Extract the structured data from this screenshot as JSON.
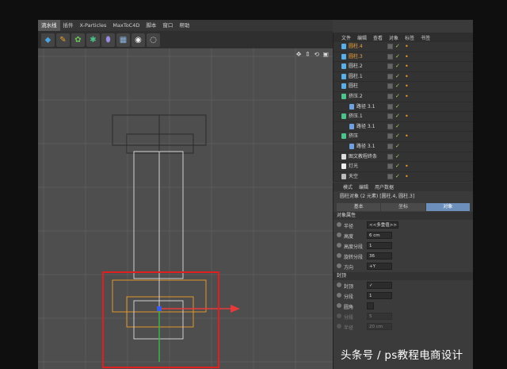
{
  "menubar": {
    "items": [
      "流水线",
      "插件",
      "X-Particles",
      "MaxToC4D",
      "脚本",
      "窗口",
      "帮助"
    ],
    "active_index": 0
  },
  "toolbar": {
    "tools": [
      "cube-tool",
      "pen-tool",
      "brush-tool",
      "gear-tool",
      "shape-tool",
      "grid-tool",
      "camera-tool",
      "light-tool"
    ]
  },
  "viewport": {
    "nav_icons": "✥ ⇕ ⟲ ▣"
  },
  "object_manager": {
    "menu": [
      "文件",
      "编辑",
      "查看",
      "对象",
      "标签",
      "书签"
    ],
    "rows": [
      {
        "name": "圆柱.4",
        "selected": true,
        "icon": "cylinder-icon",
        "indent": 0,
        "has_tag": true
      },
      {
        "name": "圆柱.3",
        "selected": true,
        "icon": "cylinder-icon",
        "indent": 0,
        "has_tag": true
      },
      {
        "name": "圆柱.2",
        "selected": false,
        "icon": "cylinder-icon",
        "indent": 0,
        "has_tag": true
      },
      {
        "name": "圆柱.1",
        "selected": false,
        "icon": "cylinder-icon",
        "indent": 0,
        "has_tag": true
      },
      {
        "name": "圆柱",
        "selected": false,
        "icon": "cylinder-icon",
        "indent": 0,
        "has_tag": true
      },
      {
        "name": "挤压.2",
        "selected": false,
        "icon": "extrude-icon",
        "indent": 0,
        "has_tag": true
      },
      {
        "name": "路径 3.1",
        "selected": false,
        "icon": "spline-icon",
        "indent": 1,
        "has_tag": false
      },
      {
        "name": "挤压.1",
        "selected": false,
        "icon": "extrude-icon",
        "indent": 0,
        "has_tag": true
      },
      {
        "name": "路径 3.1",
        "selected": false,
        "icon": "spline-icon",
        "indent": 1,
        "has_tag": false
      },
      {
        "name": "挤压",
        "selected": false,
        "icon": "extrude-icon",
        "indent": 0,
        "has_tag": true
      },
      {
        "name": "路径 3.1",
        "selected": false,
        "icon": "spline-icon",
        "indent": 1,
        "has_tag": false
      },
      {
        "name": "图文教程终条",
        "selected": false,
        "icon": "text-icon",
        "indent": 0,
        "has_tag": false
      },
      {
        "name": "灯光",
        "selected": false,
        "icon": "light-icon",
        "indent": 0,
        "has_tag": true
      },
      {
        "name": "天空",
        "selected": false,
        "icon": "sky-icon",
        "indent": 0,
        "has_tag": true
      }
    ]
  },
  "attributes": {
    "menu": [
      "模式",
      "编辑",
      "用户数据"
    ],
    "title": "圆柱对象 (2 元素) [圆柱.4, 圆柱.3]",
    "tabs": [
      "基本",
      "坐标",
      "对象"
    ],
    "active_tab": 2,
    "section_object": "对象属性",
    "props": [
      {
        "label": "半径",
        "value": "<<多重值>>"
      },
      {
        "label": "高度",
        "value": "6 cm"
      },
      {
        "label": "高度分段",
        "value": "1"
      },
      {
        "label": "旋转分段",
        "value": "36"
      },
      {
        "label": "方向",
        "value": "+Y"
      }
    ],
    "section_caps": "封顶",
    "caps": [
      {
        "label": "封顶",
        "value": "✓",
        "dim": false
      },
      {
        "label": "分段",
        "value": "1",
        "dim": false
      },
      {
        "label": "圆角",
        "value": "",
        "dim": false
      },
      {
        "label": "分段",
        "value": "5",
        "dim": true
      },
      {
        "label": "半径",
        "value": "20 cm",
        "dim": true
      }
    ]
  },
  "watermark": "头条号 / ps教程电商设计",
  "colors": {
    "selection_red": "#e02020",
    "object_orange": "#e0962a",
    "axis_x": "#e83a3a",
    "axis_y": "#3ab14a",
    "axis_z": "#3a5ae8",
    "tab_active": "#6c8fbc"
  }
}
